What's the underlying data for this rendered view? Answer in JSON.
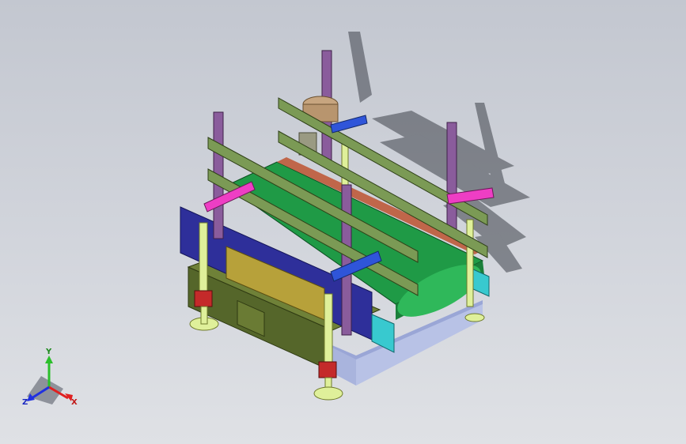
{
  "viewport": {
    "background_top": "#c3c7d0",
    "background_bottom": "#dfe1e5"
  },
  "model": {
    "colors": {
      "belt": "#1f9a46",
      "belt_roller": "#2fb85a",
      "frame_olive": "#55662a",
      "frame_olive_light": "#6f8138",
      "base_blue": "#a9b4dd",
      "post_purple": "#8a5c9c",
      "rail_green": "#7b9a55",
      "clamp_magenta": "#ee3ec4",
      "clamp_blue": "#2f55d9",
      "leg_yellow": "#dff09a",
      "leg_red": "#c42a2a",
      "cyan_block": "#38c9cf",
      "side_guard_navy": "#2e2f9a",
      "motor_tan": "#c7a57f"
    }
  },
  "triad": {
    "x_label": "X",
    "y_label": "Y",
    "z_label": "Z",
    "x_color": "#e02020",
    "y_color": "#2bbf2b",
    "z_color": "#2030e0"
  }
}
